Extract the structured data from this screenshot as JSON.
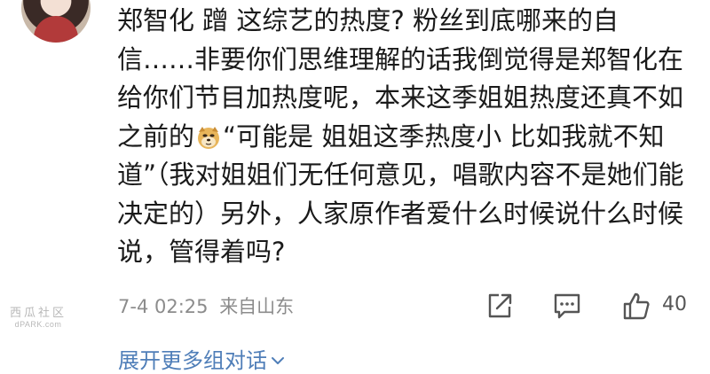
{
  "comment": {
    "text_before_emoji": "郑智化 蹭 这综艺的热度? 粉丝到底哪来的自信……非要你们思维理解的话我倒觉得是郑智化在给你们节目加热度呢，本来这季姐姐热度还真不如之前的",
    "emoji_name": "doge-emoji",
    "text_after_emoji": "“可能是 姐姐这季热度小 比如我就不知道”（我对姐姐们无任何意见，唱歌内容不是她们能决定的）另外，人家原作者爱什么时候说什么时候说，管得着吗?"
  },
  "meta": {
    "timestamp": "7-4 02:25",
    "source": "来自山东"
  },
  "actions": {
    "share_icon": "share-icon",
    "comment_icon": "comment-icon",
    "like_icon": "thumbs-up-icon",
    "like_count": "40"
  },
  "expand": {
    "label": "展开更多组对话"
  },
  "watermark": {
    "line1": "西瓜社区",
    "line2": "dPARK.com"
  },
  "colors": {
    "text": "#1a1a1a",
    "meta": "#8c8c8c",
    "link": "#4f7eb8",
    "icon": "#555555"
  }
}
